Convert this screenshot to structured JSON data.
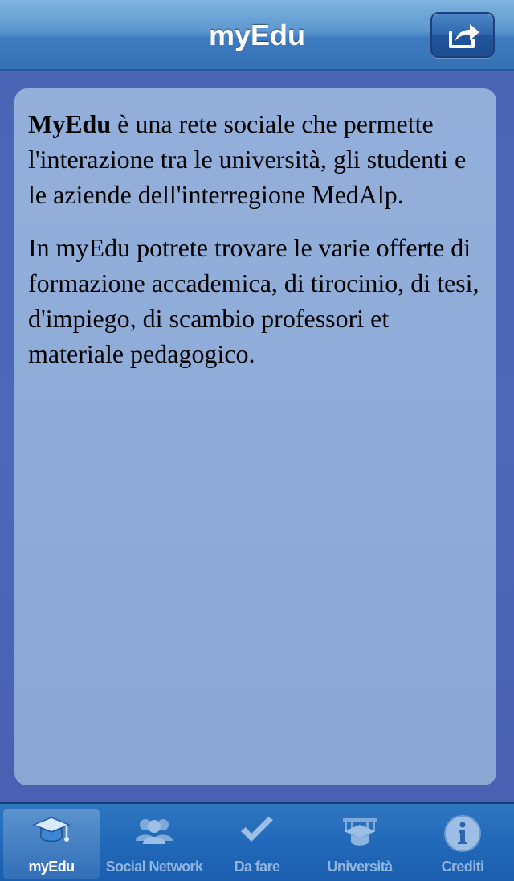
{
  "navbar": {
    "title": "myEdu",
    "share_icon": "share-icon"
  },
  "content": {
    "brand": "MyEdu",
    "paragraph1_rest": " è una rete sociale che permette l'interazione tra le università, gli studenti e le aziende dell'interregione MedAlp.",
    "paragraph2": "In myEdu potrete trovare le varie offerte di formazione accademica, di tirocinio, di tesi, d'impiego, di scambio professori et materiale pedagogico."
  },
  "tabbar": {
    "tabs": [
      {
        "label": "myEdu",
        "icon": "graduation-cap-icon",
        "selected": true
      },
      {
        "label": "Social Network",
        "icon": "people-icon",
        "selected": false
      },
      {
        "label": "Da fare",
        "icon": "checkmark-icon",
        "selected": false
      },
      {
        "label": "Università",
        "icon": "university-icon",
        "selected": false
      },
      {
        "label": "Crediti",
        "icon": "info-icon",
        "selected": false
      }
    ]
  },
  "colors": {
    "navbar": "#4a88c8",
    "background": "#4a60b2",
    "card": "#8eaad7",
    "tabbar": "#236aba",
    "tab_inactive_label": "#8fb4df",
    "tab_active_label": "#ffffff"
  }
}
